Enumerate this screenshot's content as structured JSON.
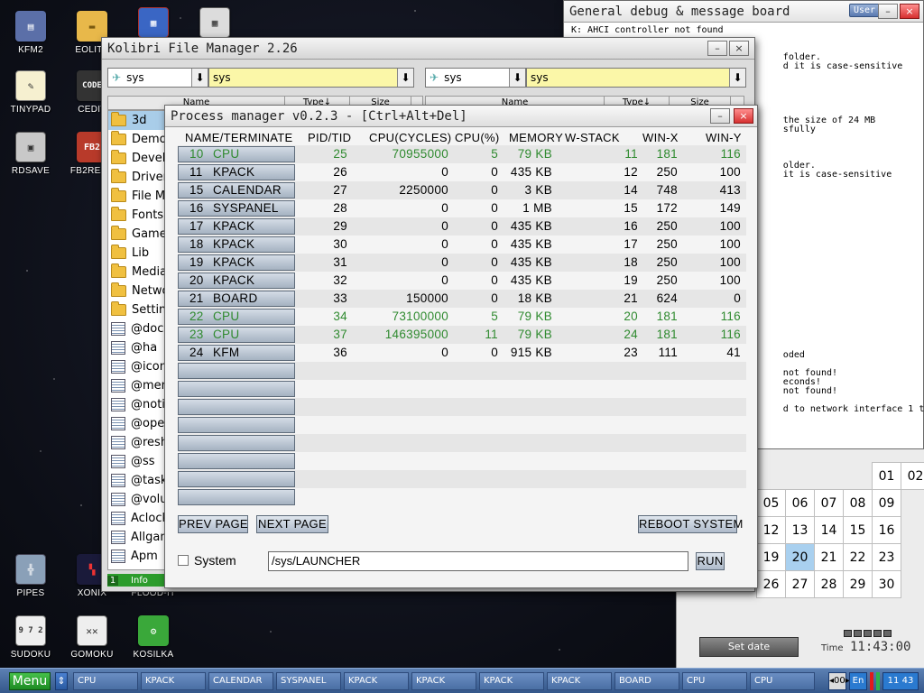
{
  "desktop_icons": [
    {
      "label": "KFM2",
      "icon": "floppy-icon"
    },
    {
      "label": "EOLITE",
      "icon": "folder-icon"
    },
    {
      "label": "",
      "icon": "app-icon"
    },
    {
      "label": "",
      "icon": "calculator-icon"
    },
    {
      "label": "TINYPAD",
      "icon": "notepad-icon"
    },
    {
      "label": "CEDIT",
      "icon": "code-icon"
    },
    {
      "label": "RDSAVE",
      "icon": "rdsave-icon"
    },
    {
      "label": "FB2READ",
      "icon": "book-icon"
    },
    {
      "label": "PIPES",
      "icon": "pipes-icon"
    },
    {
      "label": "XONIX",
      "icon": "xonix-icon"
    },
    {
      "label": "FLOOD-IT",
      "icon": "flood-icon"
    },
    {
      "label": "SUDOKU",
      "icon": "sudoku-icon"
    },
    {
      "label": "GOMOKU",
      "icon": "gomoku-icon"
    },
    {
      "label": "KOSILKA",
      "icon": "lawnmower-icon"
    }
  ],
  "debug_board": {
    "title": "General debug & message board",
    "user_button": "User",
    "lines": [
      "K: AHCI controller not found",
      "",
      "",
      "                                       folder.",
      "                                       d it is case-sensitive",
      "",
      "",
      "",
      "",
      "",
      "                                       the size of 24 MB",
      "                                       sfully",
      "",
      "",
      "",
      "                                       older.",
      "                                       it is case-sensitive",
      "",
      "",
      "",
      "",
      "",
      "",
      "",
      "",
      "",
      "",
      "",
      "",
      "",
      "",
      "",
      "",
      "",
      "",
      "",
      "                                       oded",
      "",
      "                                       not found!",
      "                                       econds!",
      "                                       not found!",
      "",
      "                                       d to network interface 1 thr"
    ]
  },
  "calendar": {
    "days": [
      "",
      "",
      "",
      "",
      "01",
      "02",
      "05",
      "06",
      "07",
      "08",
      "09",
      "",
      "12",
      "13",
      "14",
      "15",
      "16",
      "",
      "19",
      "20",
      "21",
      "22",
      "23",
      "",
      "26",
      "27",
      "28",
      "29",
      "30",
      ""
    ],
    "today": "20",
    "set_date_label": "Set date",
    "time_label": "Time",
    "time_value": "11:43:00"
  },
  "file_manager": {
    "title": "Kolibri File Manager 2.26",
    "left_drive": "sys",
    "left_path": "sys",
    "right_drive": "sys",
    "right_path": "sys",
    "columns": {
      "name": "Name",
      "type": "Type↓",
      "size": "Size"
    },
    "items": [
      {
        "name": "3d",
        "kind": "folder",
        "selected": true
      },
      {
        "name": "Demos",
        "kind": "folder"
      },
      {
        "name": "Develop",
        "kind": "folder"
      },
      {
        "name": "Drivers",
        "kind": "folder"
      },
      {
        "name": "File M",
        "kind": "folder"
      },
      {
        "name": "Fonts",
        "kind": "folder"
      },
      {
        "name": "Games",
        "kind": "folder"
      },
      {
        "name": "Lib",
        "kind": "folder"
      },
      {
        "name": "Media",
        "kind": "folder"
      },
      {
        "name": "Network",
        "kind": "folder"
      },
      {
        "name": "Settings",
        "kind": "folder"
      },
      {
        "name": "@docky",
        "kind": "file"
      },
      {
        "name": "@ha",
        "kind": "file"
      },
      {
        "name": "@icon",
        "kind": "file"
      },
      {
        "name": "@menu",
        "kind": "file"
      },
      {
        "name": "@notify",
        "kind": "file"
      },
      {
        "name": "@open",
        "kind": "file"
      },
      {
        "name": "@reshare",
        "kind": "file"
      },
      {
        "name": "@ss",
        "kind": "file"
      },
      {
        "name": "@taskbar",
        "kind": "file"
      },
      {
        "name": "@volume",
        "kind": "file"
      },
      {
        "name": "Aclock",
        "kind": "file"
      },
      {
        "name": "Allgames",
        "kind": "file"
      },
      {
        "name": "Apm",
        "kind": "file"
      }
    ],
    "status_num": "1",
    "status_text": "Info"
  },
  "process_manager": {
    "title": "Process manager v0.2.3 - [Ctrl+Alt+Del]",
    "headers": [
      "NAME/TERMINATE",
      "PID/TID",
      "CPU(CYCLES)",
      "CPU(%)",
      "MEMORY",
      "W-STACK",
      "WIN-X",
      "WIN-Y"
    ],
    "rows": [
      {
        "slot": "10",
        "name": "CPU",
        "pid": "25",
        "cycles": "70955000",
        "cpu": "5",
        "mem": "79 KB",
        "wstack": "11",
        "winx": "181",
        "winy": "116",
        "sys": true
      },
      {
        "slot": "11",
        "name": "KPACK",
        "pid": "26",
        "cycles": "0",
        "cpu": "0",
        "mem": "435 KB",
        "wstack": "12",
        "winx": "250",
        "winy": "100"
      },
      {
        "slot": "15",
        "name": "CALENDAR",
        "pid": "27",
        "cycles": "2250000",
        "cpu": "0",
        "mem": "3 KB",
        "wstack": "14",
        "winx": "748",
        "winy": "413"
      },
      {
        "slot": "16",
        "name": "SYSPANEL",
        "pid": "28",
        "cycles": "0",
        "cpu": "0",
        "mem": "1 MB",
        "wstack": "15",
        "winx": "172",
        "winy": "149"
      },
      {
        "slot": "17",
        "name": "KPACK",
        "pid": "29",
        "cycles": "0",
        "cpu": "0",
        "mem": "435 KB",
        "wstack": "16",
        "winx": "250",
        "winy": "100"
      },
      {
        "slot": "18",
        "name": "KPACK",
        "pid": "30",
        "cycles": "0",
        "cpu": "0",
        "mem": "435 KB",
        "wstack": "17",
        "winx": "250",
        "winy": "100"
      },
      {
        "slot": "19",
        "name": "KPACK",
        "pid": "31",
        "cycles": "0",
        "cpu": "0",
        "mem": "435 KB",
        "wstack": "18",
        "winx": "250",
        "winy": "100"
      },
      {
        "slot": "20",
        "name": "KPACK",
        "pid": "32",
        "cycles": "0",
        "cpu": "0",
        "mem": "435 KB",
        "wstack": "19",
        "winx": "250",
        "winy": "100"
      },
      {
        "slot": "21",
        "name": "BOARD",
        "pid": "33",
        "cycles": "150000",
        "cpu": "0",
        "mem": "18 KB",
        "wstack": "21",
        "winx": "624",
        "winy": "0"
      },
      {
        "slot": "22",
        "name": "CPU",
        "pid": "34",
        "cycles": "73100000",
        "cpu": "5",
        "mem": "79 KB",
        "wstack": "20",
        "winx": "181",
        "winy": "116",
        "sys": true
      },
      {
        "slot": "23",
        "name": "CPU",
        "pid": "37",
        "cycles": "146395000",
        "cpu": "11",
        "mem": "79 KB",
        "wstack": "24",
        "winx": "181",
        "winy": "116",
        "sys": true
      },
      {
        "slot": "24",
        "name": "KFM",
        "pid": "36",
        "cycles": "0",
        "cpu": "0",
        "mem": "915 KB",
        "wstack": "23",
        "winx": "111",
        "winy": "41"
      }
    ],
    "empty_rows": 8,
    "prev_page": "PREV PAGE",
    "next_page": "NEXT PAGE",
    "reboot": "REBOOT SYSTEM",
    "system_label": "System",
    "run_value": "/sys/LAUNCHER",
    "run_button": "RUN"
  },
  "taskbar": {
    "menu_label": "Menu",
    "switch_label": "⇕",
    "tasks": [
      "CPU",
      "KPACK",
      "CALENDAR",
      "SYSPANEL",
      "KPACK",
      "KPACK",
      "KPACK",
      "KPACK",
      "BOARD",
      "CPU",
      "CPU"
    ],
    "tray_arrows": "◂00▸",
    "lang": "En",
    "clock": "11 43"
  },
  "colors": {
    "system_process_text": "#2f8a2f",
    "taskbar": "#4a6fa4",
    "menu_green": "#2d9a33",
    "path_field": "#fbf7a8"
  }
}
